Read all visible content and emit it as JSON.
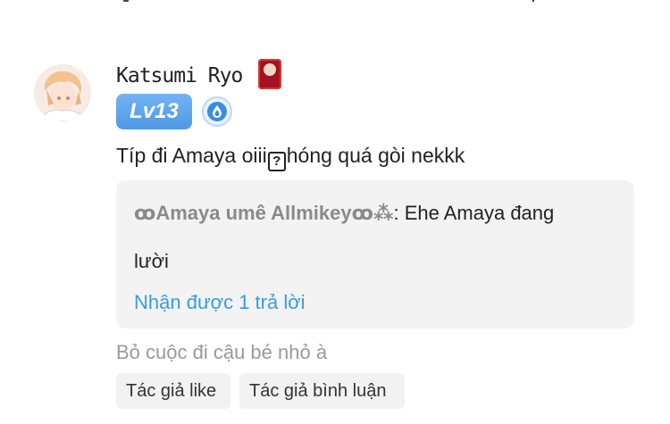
{
  "comment": {
    "username": "Katsumi Ryo",
    "level": "Lv13",
    "text_before": "Típ đi Amaya oiii",
    "unknown_glyph": "?",
    "text_after": "hóng quá gòi nekkk",
    "icons": {
      "avatar": "anime-avatar",
      "badge_decoration": "red-card-icon",
      "verified": "blue-water-drop-badge-icon"
    }
  },
  "reply": {
    "author": "ꝏAmaya umê Allmikeyꝏ⁂",
    "text_line1": ": Ehe Amaya đang",
    "text_line2": "lười",
    "reply_count": "Nhận được 1 trả lời"
  },
  "status_text": "Bỏ cuộc đi cậu bé nhỏ à",
  "tags": [
    "Tác giả like",
    "Tác giả bình luận"
  ],
  "colors": {
    "level_badge": "#5aa3ea",
    "link": "#3a9be0",
    "reply_bg": "#f3f3f3",
    "muted_text": "#9a9a9a"
  }
}
